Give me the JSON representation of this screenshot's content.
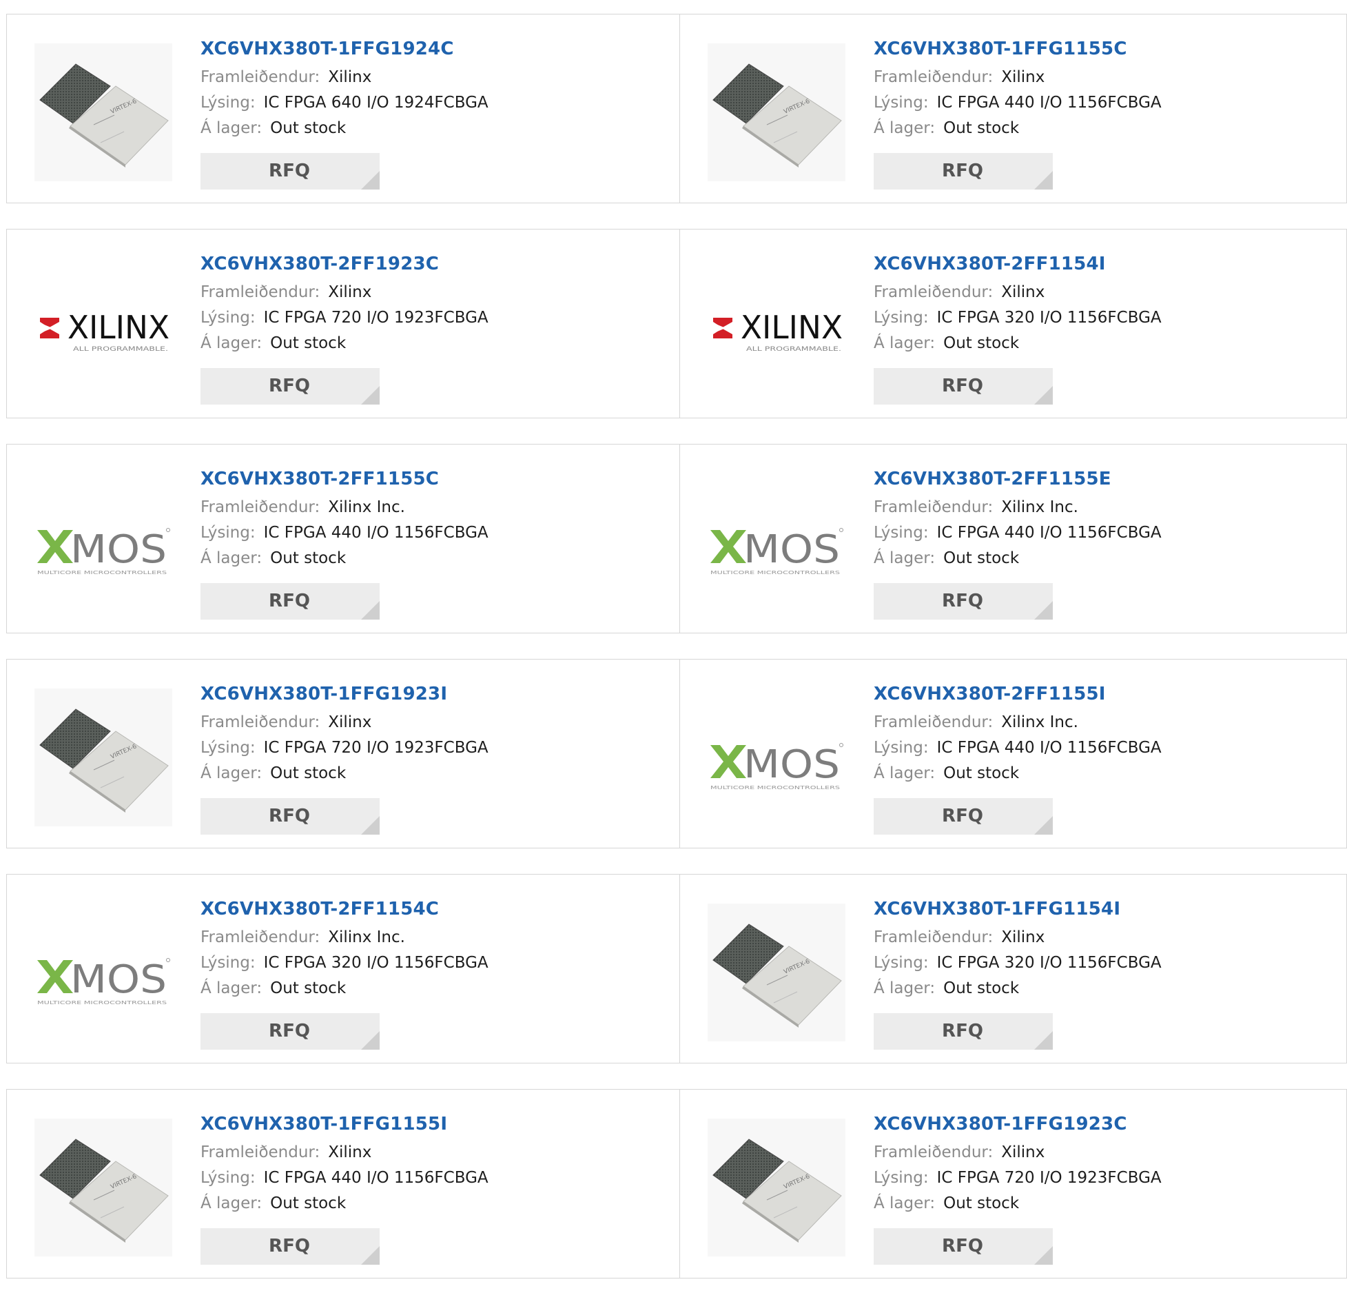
{
  "labels": {
    "manufacturer": "Framleiðendur:",
    "description": "Lýsing:",
    "stock": "Á lager:",
    "rfq": "RFQ"
  },
  "logos": {
    "xilinx_word": "XILINX",
    "xilinx_tagline": "ALL PROGRAMMABLE.",
    "xmos_word": "MOS",
    "xmos_tagline": "MULTICORE MICROCONTROLLERS",
    "chip_brand": "VIRTEX-6"
  },
  "colors": {
    "part_link": "#1f62ad",
    "xilinx_red": "#d31f26",
    "xmos_green": "#7ab648",
    "rfq_bg": "#ececec"
  },
  "products": [
    {
      "part": "XC6VHX380T-1FFG1924C",
      "manufacturer": "Xilinx",
      "description": "IC FPGA 640 I/O 1924FCBGA",
      "stock": "Out stock",
      "image": "chip"
    },
    {
      "part": "XC6VHX380T-1FFG1155C",
      "manufacturer": "Xilinx",
      "description": "IC FPGA 440 I/O 1156FCBGA",
      "stock": "Out stock",
      "image": "chip"
    },
    {
      "part": "XC6VHX380T-2FF1923C",
      "manufacturer": "Xilinx",
      "description": "IC FPGA 720 I/O 1923FCBGA",
      "stock": "Out stock",
      "image": "xilinx-logo"
    },
    {
      "part": "XC6VHX380T-2FF1154I",
      "manufacturer": "Xilinx",
      "description": "IC FPGA 320 I/O 1156FCBGA",
      "stock": "Out stock",
      "image": "xilinx-logo"
    },
    {
      "part": "XC6VHX380T-2FF1155C",
      "manufacturer": "Xilinx Inc.",
      "description": "IC FPGA 440 I/O 1156FCBGA",
      "stock": "Out stock",
      "image": "xmos-logo"
    },
    {
      "part": "XC6VHX380T-2FF1155E",
      "manufacturer": "Xilinx Inc.",
      "description": "IC FPGA 440 I/O 1156FCBGA",
      "stock": "Out stock",
      "image": "xmos-logo"
    },
    {
      "part": "XC6VHX380T-1FFG1923I",
      "manufacturer": "Xilinx",
      "description": "IC FPGA 720 I/O 1923FCBGA",
      "stock": "Out stock",
      "image": "chip"
    },
    {
      "part": "XC6VHX380T-2FF1155I",
      "manufacturer": "Xilinx Inc.",
      "description": "IC FPGA 440 I/O 1156FCBGA",
      "stock": "Out stock",
      "image": "xmos-logo"
    },
    {
      "part": "XC6VHX380T-2FF1154C",
      "manufacturer": "Xilinx Inc.",
      "description": "IC FPGA 320 I/O 1156FCBGA",
      "stock": "Out stock",
      "image": "xmos-logo"
    },
    {
      "part": "XC6VHX380T-1FFG1154I",
      "manufacturer": "Xilinx",
      "description": "IC FPGA 320 I/O 1156FCBGA",
      "stock": "Out stock",
      "image": "chip"
    },
    {
      "part": "XC6VHX380T-1FFG1155I",
      "manufacturer": "Xilinx",
      "description": "IC FPGA 440 I/O 1156FCBGA",
      "stock": "Out stock",
      "image": "chip"
    },
    {
      "part": "XC6VHX380T-1FFG1923C",
      "manufacturer": "Xilinx",
      "description": "IC FPGA 720 I/O 1923FCBGA",
      "stock": "Out stock",
      "image": "chip"
    }
  ]
}
